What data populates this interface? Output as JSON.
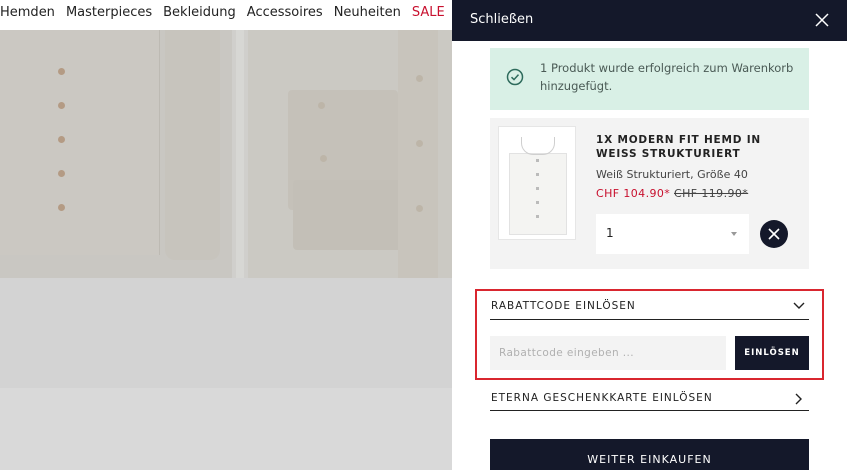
{
  "nav": {
    "items": [
      "Hemden",
      "Masterpieces",
      "Bekleidung",
      "Accessoires",
      "Neuheiten"
    ],
    "sale_label": "SALE",
    "truncated_label": "E"
  },
  "drawer": {
    "close_label": "Schließen",
    "success_message": "1 Produkt wurde erfolgreich zum Warenkorb hinzugefügt.",
    "product": {
      "name": "1x Modern Fit Hemd in weiss strukturiert",
      "variant": "Weiß Strukturiert, Größe 40",
      "price_now": "CHF 104.90*",
      "price_old": "CHF 119.90*",
      "quantity": "1"
    },
    "coupon": {
      "label": "Rabattcode einlösen",
      "placeholder": "Rabattcode eingeben ...",
      "apply_label": "EINLÖSEN"
    },
    "gift_card_label": "Eterna Geschenkkarte einlösen",
    "continue_label": "Weiter einkaufen"
  },
  "colors": {
    "drawer_header": "#14182a",
    "success_bg": "#d9f0e6",
    "sale_red": "#c8102e",
    "highlight_red": "#d9262f"
  },
  "icons": {
    "close": "close-icon",
    "success": "check-circle-icon",
    "remove": "remove-x-icon",
    "coupon_toggle": "chevron-down-icon",
    "gift_toggle": "chevron-right-icon",
    "qty_toggle": "caret-down-icon"
  }
}
